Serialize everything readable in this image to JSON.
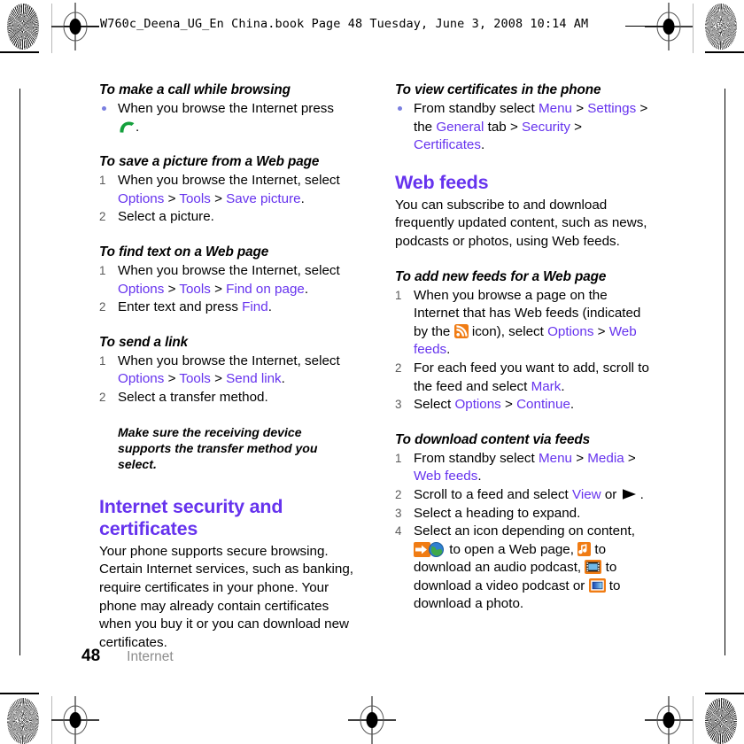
{
  "header": {
    "text": "W760c_Deena_UG_En China.book  Page 48  Tuesday, June 3, 2008  10:14 AM"
  },
  "colors": {
    "link": "#6633ee",
    "heading": "#6633ee",
    "orange": "#f07c14",
    "green": "#14a03c",
    "chapter_gray": "#8c8c8c"
  },
  "left_column": {
    "sections": [
      {
        "heading": "To make a call while browsing",
        "bullets": [
          {
            "pre": "When you browse the Internet press ",
            "icon": "call-icon",
            "post": "."
          }
        ]
      },
      {
        "heading": "To save a picture from a Web page",
        "steps": [
          {
            "num": "1",
            "parts": [
              {
                "t": "When you browse the Internet, select ",
                "k": "n"
              },
              {
                "t": "Options",
                "k": "l"
              },
              {
                "t": " > ",
                "k": "n"
              },
              {
                "t": "Tools",
                "k": "l"
              },
              {
                "t": " > ",
                "k": "n"
              },
              {
                "t": "Save picture",
                "k": "l"
              },
              {
                "t": ".",
                "k": "n"
              }
            ]
          },
          {
            "num": "2",
            "parts": [
              {
                "t": "Select a picture.",
                "k": "n"
              }
            ]
          }
        ]
      },
      {
        "heading": "To find text on a Web page",
        "steps": [
          {
            "num": "1",
            "parts": [
              {
                "t": "When you browse the Internet, select ",
                "k": "n"
              },
              {
                "t": "Options",
                "k": "l"
              },
              {
                "t": " > ",
                "k": "n"
              },
              {
                "t": "Tools",
                "k": "l"
              },
              {
                "t": " > ",
                "k": "n"
              },
              {
                "t": "Find on page",
                "k": "l"
              },
              {
                "t": ".",
                "k": "n"
              }
            ]
          },
          {
            "num": "2",
            "parts": [
              {
                "t": "Enter text and press ",
                "k": "n"
              },
              {
                "t": "Find",
                "k": "l"
              },
              {
                "t": ".",
                "k": "n"
              }
            ]
          }
        ]
      },
      {
        "heading": "To send a link",
        "steps": [
          {
            "num": "1",
            "parts": [
              {
                "t": "When you browse the Internet, select ",
                "k": "n"
              },
              {
                "t": "Options",
                "k": "l"
              },
              {
                "t": " > ",
                "k": "n"
              },
              {
                "t": "Tools",
                "k": "l"
              },
              {
                "t": " > ",
                "k": "n"
              },
              {
                "t": "Send link",
                "k": "l"
              },
              {
                "t": ".",
                "k": "n"
              }
            ]
          },
          {
            "num": "2",
            "parts": [
              {
                "t": "Select a transfer method.",
                "k": "n"
              }
            ]
          }
        ]
      }
    ],
    "note": "Make sure the receiving device supports the transfer method you select.",
    "section_heading": "Internet security and certificates",
    "section_body": "Your phone supports secure browsing. Certain Internet services, such as banking, require certificates in your phone. Your phone may already contain certificates when you buy it or you can download new certificates."
  },
  "right_column": {
    "proc1_heading": "To view certificates in the phone",
    "proc1_bullet": [
      {
        "t": "From standby select ",
        "k": "n"
      },
      {
        "t": "Menu",
        "k": "l"
      },
      {
        "t": " > ",
        "k": "n"
      },
      {
        "t": "Settings",
        "k": "l"
      },
      {
        "t": " > the ",
        "k": "n"
      },
      {
        "t": "General",
        "k": "l"
      },
      {
        "t": " tab > ",
        "k": "n"
      },
      {
        "t": "Security",
        "k": "l"
      },
      {
        "t": " > ",
        "k": "n"
      },
      {
        "t": "Certificates",
        "k": "l"
      },
      {
        "t": ".",
        "k": "n"
      }
    ],
    "section_heading": "Web feeds",
    "section_body": "You can subscribe to and download frequently updated content, such as news, podcasts or photos, using Web feeds.",
    "proc2_heading": "To add new feeds for a Web page",
    "proc2_steps": [
      {
        "num": "1",
        "parts": [
          {
            "t": "When you browse a page on the Internet that has Web feeds (indicated by the ",
            "k": "n"
          },
          {
            "t": "",
            "k": "icon-rss"
          },
          {
            "t": " icon), select ",
            "k": "n"
          },
          {
            "t": "Options",
            "k": "l"
          },
          {
            "t": " > ",
            "k": "n"
          },
          {
            "t": "Web feeds",
            "k": "l"
          },
          {
            "t": ".",
            "k": "n"
          }
        ]
      },
      {
        "num": "2",
        "parts": [
          {
            "t": "For each feed you want to add, scroll to the feed and select ",
            "k": "n"
          },
          {
            "t": "Mark",
            "k": "l"
          },
          {
            "t": ".",
            "k": "n"
          }
        ]
      },
      {
        "num": "3",
        "parts": [
          {
            "t": "Select ",
            "k": "n"
          },
          {
            "t": "Options",
            "k": "l"
          },
          {
            "t": " > ",
            "k": "n"
          },
          {
            "t": "Continue",
            "k": "l"
          },
          {
            "t": ".",
            "k": "n"
          }
        ]
      }
    ],
    "proc3_heading": "To download content via feeds",
    "proc3_steps": [
      {
        "num": "1",
        "parts": [
          {
            "t": "From standby select ",
            "k": "n"
          },
          {
            "t": "Menu",
            "k": "l"
          },
          {
            "t": " > ",
            "k": "n"
          },
          {
            "t": "Media",
            "k": "l"
          },
          {
            "t": " > ",
            "k": "n"
          },
          {
            "t": "Web feeds",
            "k": "l"
          },
          {
            "t": ".",
            "k": "n"
          }
        ]
      },
      {
        "num": "2",
        "parts": [
          {
            "t": "Scroll to a feed and select ",
            "k": "n"
          },
          {
            "t": "View",
            "k": "l"
          },
          {
            "t": " or ",
            "k": "n"
          },
          {
            "t": "",
            "k": "icon-play"
          },
          {
            "t": ".",
            "k": "n"
          }
        ]
      },
      {
        "num": "3",
        "parts": [
          {
            "t": "Select a heading to expand.",
            "k": "n"
          }
        ]
      },
      {
        "num": "4",
        "parts": [
          {
            "t": "Select an icon depending on content, ",
            "k": "n"
          },
          {
            "t": "",
            "k": "icon-web"
          },
          {
            "t": " to open a Web page, ",
            "k": "n"
          },
          {
            "t": "",
            "k": "icon-audio"
          },
          {
            "t": " to download an audio podcast, ",
            "k": "n"
          },
          {
            "t": "",
            "k": "icon-video"
          },
          {
            "t": " to download a video podcast or ",
            "k": "n"
          },
          {
            "t": "",
            "k": "icon-photo"
          },
          {
            "t": " to download a photo.",
            "k": "n"
          }
        ]
      }
    ]
  },
  "footer": {
    "page_number": "48",
    "chapter": "Internet"
  }
}
